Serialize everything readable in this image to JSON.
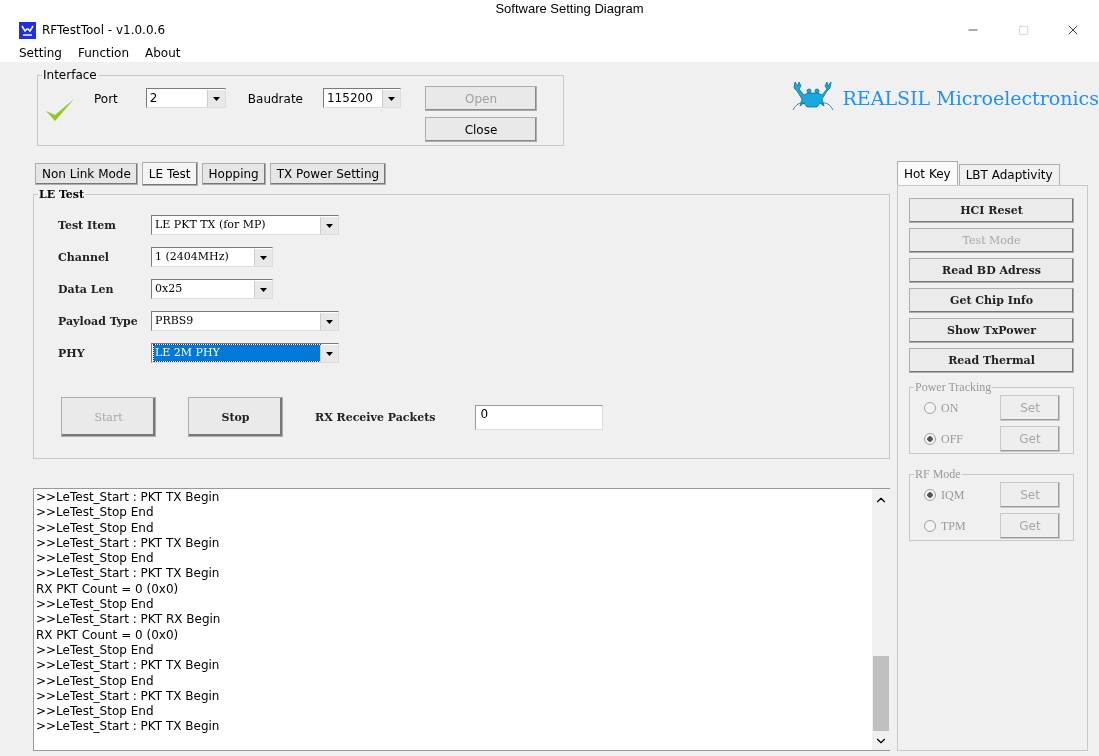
{
  "caption": "Software Setting Diagram",
  "window": {
    "title": "RFTestTool - v1.0.0.6"
  },
  "menu": [
    "Setting",
    "Function",
    "About"
  ],
  "interface": {
    "title": "Interface",
    "connected": true,
    "fields": [
      {
        "label": "Port",
        "value": "2"
      },
      {
        "label": "Baudrate",
        "value": "115200"
      }
    ],
    "buttons": [
      {
        "label": "Open",
        "disabled": true
      },
      {
        "label": "Close",
        "disabled": false
      }
    ]
  },
  "logo": {
    "text": "REALSIL Microelectronics"
  },
  "tabs": [
    {
      "label": "Non Link Mode",
      "selected": false
    },
    {
      "label": "LE Test",
      "selected": true
    },
    {
      "label": "Hopping",
      "selected": false
    },
    {
      "label": "TX Power Setting",
      "selected": false
    }
  ],
  "le_test": {
    "title": "LE Test",
    "fields": [
      {
        "label": "Test Item",
        "value": "LE PKT TX (for MP)",
        "highlighted": false
      },
      {
        "label": "Channel",
        "value": "1  (2404MHz)",
        "highlighted": false
      },
      {
        "label": "Data Len",
        "value": "0x25",
        "highlighted": false
      },
      {
        "label": "Payload Type",
        "value": "PRBS9",
        "highlighted": false
      },
      {
        "label": "PHY",
        "value": "LE 2M PHY",
        "highlighted": true
      }
    ],
    "buttons": [
      {
        "label": "Start",
        "disabled": true
      },
      {
        "label": "Stop",
        "disabled": false
      }
    ],
    "rx": {
      "label": "RX Receive Packets",
      "value": "0"
    }
  },
  "log": {
    "lines": [
      ">>LeTest_Start : PKT TX Begin",
      ">>LeTest_Stop End",
      ">>LeTest_Stop End",
      ">>LeTest_Start : PKT TX Begin",
      ">>LeTest_Stop End",
      ">>LeTest_Start : PKT TX Begin",
      "RX PKT Count = 0 (0x0)",
      ">>LeTest_Stop End",
      ">>LeTest_Start : PKT RX Begin",
      "RX PKT Count = 0 (0x0)",
      ">>LeTest_Stop End",
      ">>LeTest_Start : PKT TX Begin",
      ">>LeTest_Stop End",
      ">>LeTest_Start : PKT TX Begin",
      ">>LeTest_Stop End",
      ">>LeTest_Start : PKT TX Begin"
    ]
  },
  "side_tabs": [
    {
      "label": "Hot Key",
      "selected": true
    },
    {
      "label": "LBT Adaptivity",
      "selected": false
    }
  ],
  "hot_keys": [
    {
      "label": "HCI Reset",
      "disabled": false
    },
    {
      "label": "Test Mode",
      "disabled": true
    },
    {
      "label": "Read BD Adress",
      "disabled": false
    },
    {
      "label": "Get Chip Info",
      "disabled": false
    },
    {
      "label": "Show TxPower",
      "disabled": false
    },
    {
      "label": "Read Thermal",
      "disabled": false
    }
  ],
  "groups": [
    {
      "title": "Power Tracking",
      "options": [
        {
          "label": "ON",
          "selected": false
        },
        {
          "label": "OFF",
          "selected": true
        }
      ],
      "buttons": [
        {
          "label": "Set",
          "disabled": true
        },
        {
          "label": "Get",
          "disabled": true
        }
      ]
    },
    {
      "title": "RF Mode",
      "options": [
        {
          "label": "IQM",
          "selected": true
        },
        {
          "label": "TPM",
          "selected": false
        }
      ],
      "buttons": [
        {
          "label": "Set",
          "disabled": true
        },
        {
          "label": "Get",
          "disabled": true
        }
      ]
    }
  ]
}
